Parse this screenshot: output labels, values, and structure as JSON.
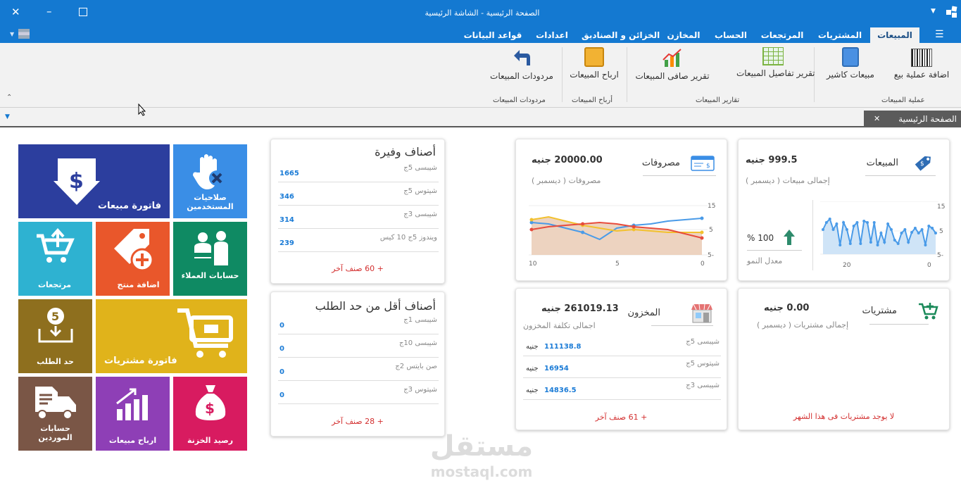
{
  "window": {
    "title": "الصفحة الرئيسية - الشاشة الرئيسية"
  },
  "tabs": [
    {
      "id": "sales",
      "label": "المبيعات"
    },
    {
      "id": "purchases",
      "label": "المشتريات"
    },
    {
      "id": "returns",
      "label": "المرتجعات"
    },
    {
      "id": "account",
      "label": "الحساب"
    },
    {
      "id": "stores",
      "label": "المخازن"
    },
    {
      "id": "boxes",
      "label": "الخزائن و الصناديق"
    },
    {
      "id": "settings",
      "label": "اعدادات"
    },
    {
      "id": "db",
      "label": "قواعد البيانات"
    }
  ],
  "ribbon": {
    "add_sale": "اضافة عملية بيع",
    "cashier_sales": "مبيعات كاشير",
    "sales_details_report": "تقرير تفاصيل المبيعات",
    "net_sales_report": "تقرير صافى المبيعات",
    "sales_profit": "ارباح المبيعات",
    "sales_returns": "مردودات المبيعات",
    "group_sales_ops": "عملية المبيعات",
    "group_sales_reports": "تقارير المبيعات",
    "group_profit": "أرباح المبيعات",
    "group_returns": "مردودات المبيعات"
  },
  "doc_tab": {
    "label": "الصفحة الرئيسية"
  },
  "sales_card": {
    "title": "المبيعات",
    "amount": "999.5",
    "currency": "جنيه",
    "subtitle": "إجمالى مبيعات ( ديسمبر )",
    "growth_value": "100",
    "growth_unit": "%",
    "growth_label": "معدل النمو",
    "y_ticks": [
      "15",
      "5",
      "5-"
    ],
    "x_ticks": [
      "20",
      "0"
    ]
  },
  "expenses_card": {
    "title": "مصروفات",
    "amount": "20000.00",
    "currency": "جنيه",
    "subtitle": "مصروفات ( ديسمبر )",
    "y_ticks": [
      "15",
      "5",
      "5-"
    ],
    "x_ticks": [
      "10",
      "5",
      "0"
    ]
  },
  "purchases_card": {
    "title": "مشتريات",
    "amount": "0.00",
    "currency": "جنيه",
    "subtitle": "إجمالى مشتريات ( ديسمبر )",
    "empty_msg": "لا يوجد مشتريات فى هذا الشهر"
  },
  "stock_card": {
    "title": "المخزون",
    "amount": "261019.13",
    "currency": "جنيه",
    "subtitle": "اجمالى تكلفة المخزون",
    "rows": [
      {
        "name": "شيبسى 5ج",
        "value": "111138.8",
        "currency": "جنيه"
      },
      {
        "name": "شيتوس 5ج",
        "value": "16954",
        "currency": "جنيه"
      },
      {
        "name": "شيبسى 3ج",
        "value": "14836.5",
        "currency": "جنيه"
      }
    ],
    "more": "+ 61 صنف آخر"
  },
  "plenty_card": {
    "title": "أصناف وفيرة",
    "rows": [
      {
        "name": "شيبسى 5ج",
        "value": "1665"
      },
      {
        "name": "شيتوس 5ج",
        "value": "346"
      },
      {
        "name": "شيبسى 3ج",
        "value": "314"
      },
      {
        "name": "ويندوز 5ج 10 كيس",
        "value": "239"
      }
    ],
    "more": "+ 60 صنف آخر"
  },
  "low_card": {
    "title": "أصناف أقل من حد الطلب",
    "rows": [
      {
        "name": "شيبسى 1ج",
        "value": "0"
      },
      {
        "name": "شيبسى 10ج",
        "value": "0"
      },
      {
        "name": "صن بايتس 2ج",
        "value": "0"
      },
      {
        "name": "شيتوس 3ج",
        "value": "0"
      }
    ],
    "more": "+ 28 صنف آخر"
  },
  "tiles": {
    "sales_invoice": "فاتورة مبيعات",
    "user_perms": "صلاحيات المستخدمين",
    "returns": "مرتجعات",
    "add_product": "اضافة منتج",
    "customer_accounts": "حسابات العملاء",
    "reorder": "حد الطلب",
    "purchase_invoice": "فاتورة مشتريات",
    "supplier_accounts": "حسابات الموردين",
    "sales_profit": "ارباح مبيعات",
    "treasury_balance": "رصيد الخزنة"
  },
  "watermark": {
    "brand": "مستقل",
    "url": "mostaql.com"
  },
  "colors": {
    "titlebar": "#1479d1",
    "blue_tile": "#3a8ee6",
    "navy_tile": "#2c3e9e",
    "teal_tile": "#00a99d",
    "cyan_tile": "#2eb2d1",
    "orange_tile": "#e9572b",
    "green_tile": "#0f8a63",
    "olive_tile": "#8e6f1e",
    "yellow_tile": "#e0b31b",
    "brown_tile": "#7a5646",
    "purple_tile": "#8e3fb6",
    "pink_tile": "#d81b60"
  }
}
